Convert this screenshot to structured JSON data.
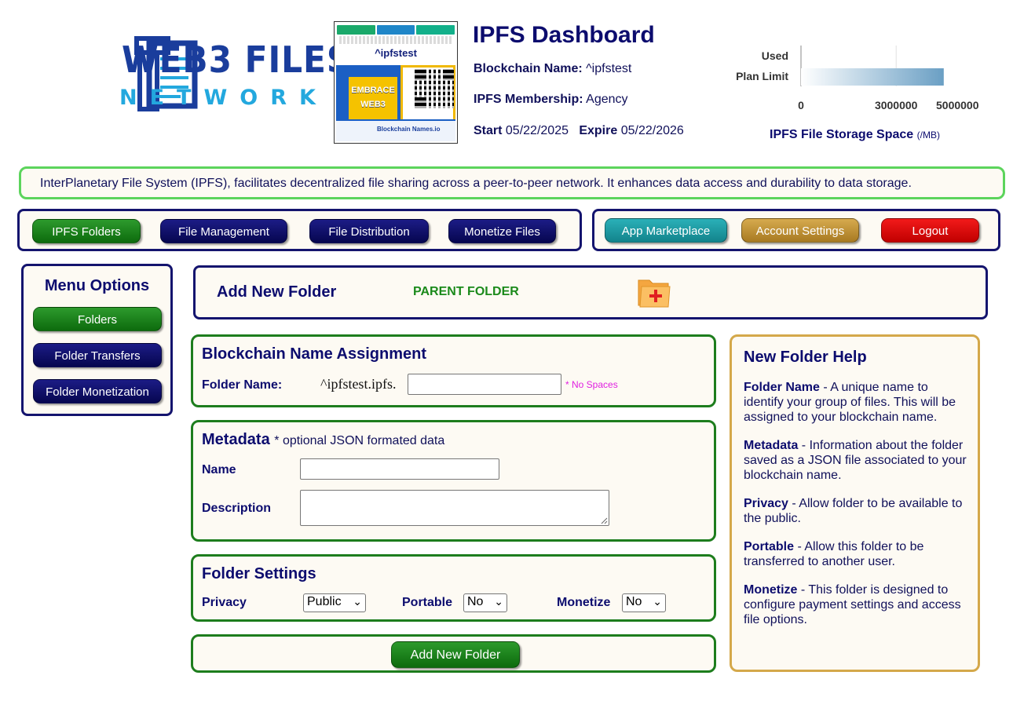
{
  "logo": {
    "word1": "WEB3 FILES",
    "word2": "NETWORK"
  },
  "badge": {
    "name": "^ipfstest",
    "embrace": "EMBRACE WEB3",
    "footer": "Blockchain Names.io"
  },
  "header": {
    "title": "IPFS Dashboard",
    "blockchain_name_label": "Blockchain Name:",
    "blockchain_name_value": "^ipfstest",
    "membership_label": "IPFS Membership:",
    "membership_value": "Agency",
    "start_label": "Start",
    "start_value": "05/22/2025",
    "expire_label": "Expire",
    "expire_value": "05/22/2026"
  },
  "chart_data": {
    "type": "bar",
    "orientation": "horizontal",
    "categories": [
      "Used",
      "Plan Limit"
    ],
    "values": [
      0,
      4500000
    ],
    "xlim": [
      0,
      5000000
    ],
    "xticks": [
      "0",
      "3000000",
      "5000000"
    ],
    "title": "IPFS File Storage Space",
    "unit": "(/MB)",
    "bar_color": "#6a9fc4"
  },
  "banner": {
    "text": "InterPlanetary File System (IPFS), facilitates decentralized file sharing across a peer-to-peer network. It enhances data access and durability to data storage."
  },
  "nav": {
    "ipfs_folders": "IPFS Folders",
    "file_management": "File Management",
    "file_distribution": "File Distribution",
    "monetize_files": "Monetize Files",
    "app_marketplace": "App Marketplace",
    "account_settings": "Account Settings",
    "logout": "Logout"
  },
  "menu": {
    "title": "Menu Options",
    "folders": "Folders",
    "folder_transfers": "Folder Transfers",
    "folder_monetization": "Folder Monetization"
  },
  "add_folder": {
    "title": "Add New Folder",
    "parent": "PARENT FOLDER"
  },
  "assignment": {
    "title": "Blockchain Name Assignment",
    "folder_name_label": "Folder Name:",
    "prefix": "^ipfstest.ipfs.",
    "folder_name_value": "",
    "hint": "* No Spaces"
  },
  "metadata": {
    "title": "Metadata",
    "subtitle": "* optional JSON formated data",
    "name_label": "Name",
    "name_value": "",
    "description_label": "Description",
    "description_value": ""
  },
  "settings": {
    "title": "Folder Settings",
    "privacy_label": "Privacy",
    "privacy_value": "Public",
    "portable_label": "Portable",
    "portable_value": "No",
    "monetize_label": "Monetize",
    "monetize_value": "No"
  },
  "submit": {
    "label": "Add New Folder"
  },
  "help": {
    "title": "New Folder Help",
    "items": [
      {
        "term": "Folder Name",
        "text": " - A unique name to identify your group of files. This will be assigned to your blockchain name."
      },
      {
        "term": "Metadata",
        "text": " - Information about the folder saved as a JSON file associated to your blockchain name."
      },
      {
        "term": "Privacy",
        "text": " - Allow folder to be available to the public."
      },
      {
        "term": "Portable",
        "text": " - Allow this folder to be transferred to another user."
      },
      {
        "term": "Monetize",
        "text": " - This folder is designed to configure payment settings and access file options."
      }
    ]
  },
  "colors": {
    "navy": "#0c0c6e",
    "green": "#1d7d1d",
    "gold_border": "#d4a84a",
    "banner_border": "#5cd45c",
    "hint_magenta": "#e020e0"
  }
}
